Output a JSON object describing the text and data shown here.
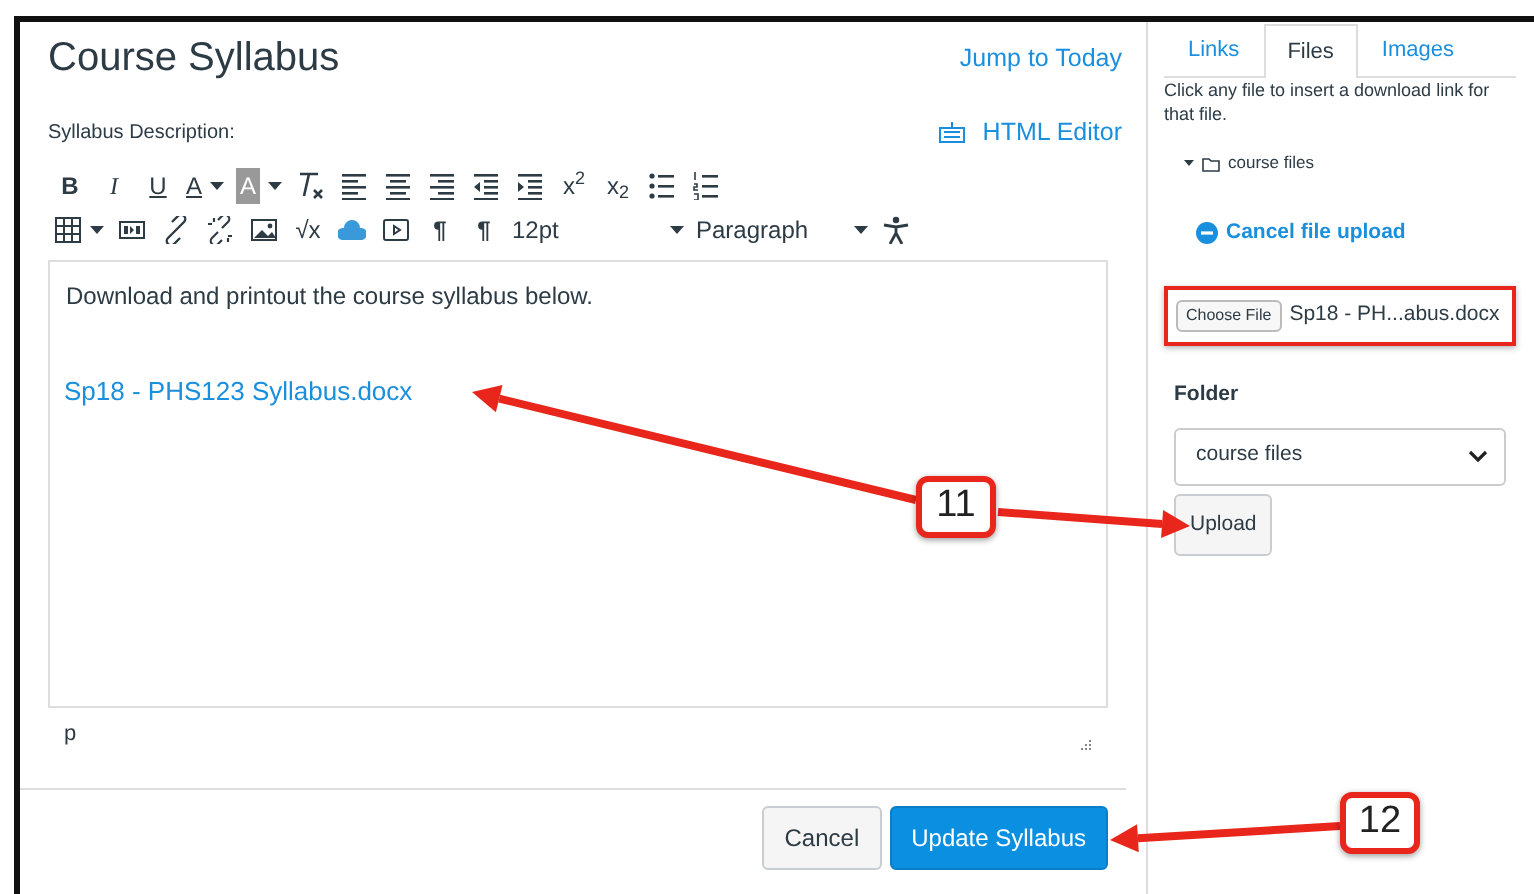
{
  "page": {
    "title": "Course Syllabus",
    "jump_link": "Jump to Today"
  },
  "editor": {
    "label": "Syllabus Description:",
    "html_editor": "HTML Editor",
    "toolbar": [
      [
        {
          "kind": "bold",
          "label": "B"
        },
        {
          "kind": "italic",
          "label": "I"
        },
        {
          "kind": "underline",
          "label": "U"
        },
        {
          "kind": "underline",
          "label": "A",
          "dropdown": true
        },
        {
          "kind": "highlight",
          "label": "A",
          "dropdown": true
        },
        {
          "kind": "icon"
        },
        {
          "kind": "icon"
        },
        {
          "kind": "icon"
        },
        {
          "kind": "icon"
        },
        {
          "kind": "icon"
        },
        {
          "kind": "icon"
        },
        {
          "kind": "plain",
          "label": "x$^{2}$"
        },
        {
          "kind": "plain",
          "label": "x$_{2}$"
        },
        {
          "kind": "icon"
        },
        {
          "kind": "icon"
        }
      ],
      [
        {
          "kind": "icon",
          "dropdown": true
        },
        {
          "kind": "icon"
        },
        {
          "kind": "icon"
        },
        {
          "kind": "icon"
        },
        {
          "kind": "icon"
        },
        {
          "kind": "plain",
          "label": "√x"
        },
        {
          "kind": "icon"
        },
        {
          "kind": "icon"
        },
        {
          "kind": "bold",
          "label": "¶"
        },
        {
          "kind": "bold",
          "label": "¶"
        },
        {
          "kind": "select",
          "label": "12pt"
        },
        {
          "kind": "select",
          "label": "Paragraph"
        },
        {
          "kind": "icon"
        }
      ]
    ],
    "content": {
      "paragraph": "Download and printout the course syllabus below.",
      "file_link": "Sp18 - PHS123 Syllabus.docx"
    },
    "path": "p"
  },
  "buttons": [
    {
      "label": "Cancel",
      "kind": "secondary"
    },
    {
      "label": "Update Syllabus",
      "kind": "primary"
    }
  ],
  "sidebar": {
    "tabs": [
      {
        "label": "Links",
        "selected": false
      },
      {
        "label": "Files",
        "selected": true
      },
      {
        "label": "Images",
        "selected": false
      }
    ],
    "hint": "Click any file to insert a download link for that file.",
    "folder_tree": {
      "label": "course files",
      "expanded": true
    },
    "cancel_upload": "Cancel file upload",
    "file_input": {
      "button": "Choose File",
      "value": "Sp18 - PH...abus.docx"
    },
    "folder_label": "Folder",
    "folder_select": "course files",
    "upload": "Upload"
  },
  "callouts": [
    {
      "label": "11"
    },
    {
      "label": "12"
    }
  ]
}
